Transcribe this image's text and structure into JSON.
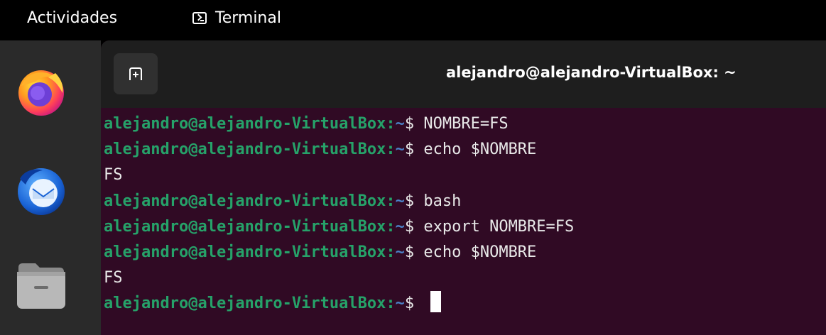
{
  "topbar": {
    "activities": "Actividades",
    "app_name": "Terminal",
    "app_icon": "terminal-icon"
  },
  "dock": {
    "items": [
      {
        "name": "Firefox",
        "icon": "firefox-icon"
      },
      {
        "name": "Thunderbird",
        "icon": "thunderbird-icon"
      },
      {
        "name": "Files",
        "icon": "files-icon"
      }
    ]
  },
  "window": {
    "title": "alejandro@alejandro-VirtualBox: ~",
    "new_tab_icon": "new-tab-icon"
  },
  "terminal": {
    "prompt_user": "alejandro@alejandro-VirtualBox",
    "prompt_sep": ":",
    "prompt_path": "~",
    "prompt_symbol": "$",
    "lines": [
      {
        "type": "cmd",
        "text": "NOMBRE=FS"
      },
      {
        "type": "cmd",
        "text": "echo $NOMBRE"
      },
      {
        "type": "out",
        "text": "FS"
      },
      {
        "type": "cmd",
        "text": "bash"
      },
      {
        "type": "cmd",
        "text": "export NOMBRE=FS"
      },
      {
        "type": "cmd",
        "text": "echo $NOMBRE"
      },
      {
        "type": "out",
        "text": "FS"
      },
      {
        "type": "cmd",
        "text": ""
      }
    ]
  },
  "colors": {
    "terminal_bg": "#300a24",
    "prompt_user": "#26a269",
    "prompt_path": "#4b82c8",
    "headerbar": "#1e1e1e"
  }
}
